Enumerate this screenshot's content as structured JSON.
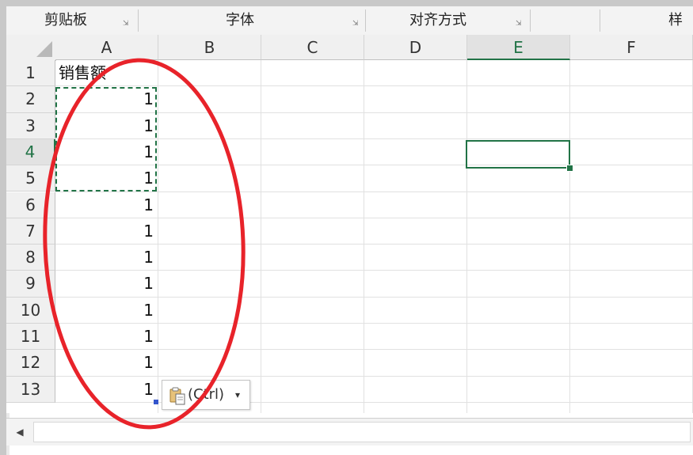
{
  "ribbon": {
    "groups": [
      {
        "label": "剪贴板"
      },
      {
        "label": "字体"
      },
      {
        "label": "对齐方式"
      },
      {
        "label": "样"
      }
    ]
  },
  "grid": {
    "columns": [
      "A",
      "B",
      "C",
      "D",
      "E",
      "F"
    ],
    "active_column": "E",
    "rows": [
      "1",
      "2",
      "3",
      "4",
      "5",
      "6",
      "7",
      "8",
      "9",
      "10",
      "11",
      "12",
      "13"
    ],
    "active_row": "4",
    "cells": {
      "A1": "销售额",
      "A2": "1",
      "A3": "1",
      "A4": "1",
      "A5": "1",
      "A6": "1",
      "A7": "1",
      "A8": "1",
      "A9": "1",
      "A10": "1",
      "A11": "1",
      "A12": "1",
      "A13": "1"
    }
  },
  "paste_options": {
    "label": "(Ctrl)",
    "caret": "▾"
  },
  "scrollbar": {
    "left_arrow": "◀"
  },
  "colors": {
    "accent": "#217346",
    "annotation": "#e8232a"
  }
}
